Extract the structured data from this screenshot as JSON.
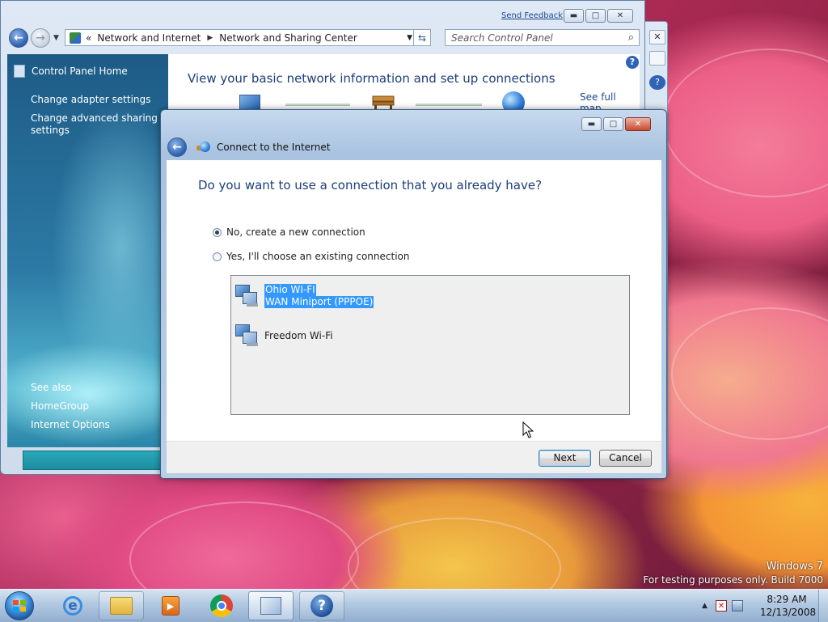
{
  "desktop": {
    "watermark_line1": "Windows  7",
    "watermark_line2": "For testing purposes only. Build 7000"
  },
  "network_window": {
    "send_feedback": "Send Feedback",
    "breadcrumb": [
      "Network and Internet",
      "Network and Sharing Center"
    ],
    "breadcrumb_prefix": "«",
    "search_placeholder": "Search Control Panel",
    "sidebar": {
      "home": "Control Panel Home",
      "links": [
        "Change adapter settings",
        "Change advanced sharing settings"
      ],
      "see_also_heading": "See also",
      "see_also": [
        "HomeGroup",
        "Internet Options"
      ]
    },
    "main_title": "View your basic network information and set up connections",
    "see_full_map": "See full map",
    "help_glyph": "?"
  },
  "dialog": {
    "title": "Connect to the Internet",
    "question": "Do you want to use a connection that you already have?",
    "options": [
      {
        "label": "No, create a new connection",
        "checked": true
      },
      {
        "label": "Yes, I'll choose an existing connection",
        "checked": false
      }
    ],
    "connections": [
      {
        "line1": "Ohio WI-FI",
        "line2": "WAN Miniport (PPPOE)",
        "selected": true
      },
      {
        "line1": "Freedom Wi-Fi",
        "line2": "",
        "selected": false
      }
    ],
    "next_label": "Next",
    "cancel_label": "Cancel"
  },
  "taskbar": {
    "ie_glyph": "e",
    "help_glyph": "?",
    "tray_up": "▲",
    "clock_time": "8:29 AM",
    "clock_date": "12/13/2008"
  },
  "window_controls": {
    "minimize": "▬",
    "maximize": "□",
    "close": "✕"
  }
}
